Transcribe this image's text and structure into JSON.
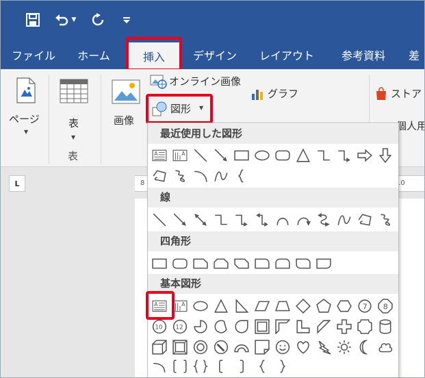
{
  "colors": {
    "ribbon_blue": "#2b579a",
    "highlight_red": "#e8001c",
    "ribbon_bg": "#f3f3f3",
    "section_header_bg": "#ededed"
  },
  "qat": {
    "save_icon": "save-icon",
    "undo_icon": "undo-icon",
    "redo_icon": "redo-icon",
    "customize_icon": "customize-qat-icon"
  },
  "tabs": [
    {
      "label": "ファイル"
    },
    {
      "label": "ホーム"
    },
    {
      "label": "挿入"
    },
    {
      "label": "デザイン"
    },
    {
      "label": "レイアウト"
    },
    {
      "label": "参考資料"
    },
    {
      "label": "差"
    }
  ],
  "ribbon": {
    "pages_label": "ページ",
    "table_label": "表",
    "table_group_label": "表",
    "picture_label": "画像",
    "online_picture_label": "オンライン画像",
    "shapes_label": "図形",
    "chart_label": "グラフ",
    "store_label": "ストア",
    "myaddins_label": "個人用"
  },
  "ruler": {
    "left_number": "8",
    "right_number": "10"
  },
  "shapes_menu": {
    "sections": [
      {
        "title": "最近使用した図形"
      },
      {
        "title": "線"
      },
      {
        "title": "四角形"
      },
      {
        "title": "基本図形"
      }
    ]
  }
}
